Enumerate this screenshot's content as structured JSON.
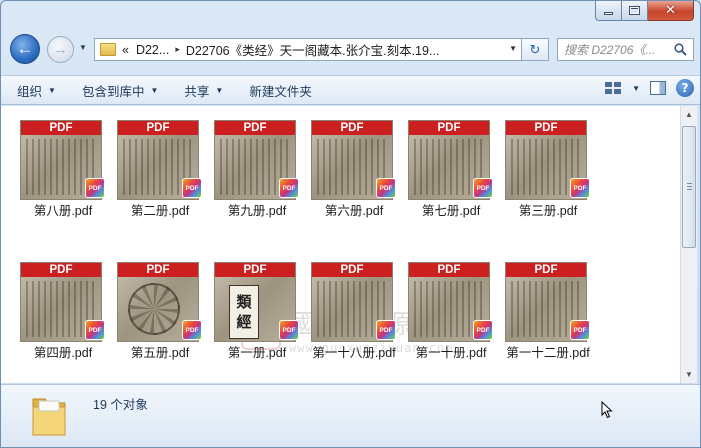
{
  "window": {
    "minimize_glyph": "",
    "maximize_glyph": "",
    "close_glyph": "✕"
  },
  "nav": {
    "back_glyph": "←",
    "forward_glyph": "→",
    "dropdown_glyph": "▼"
  },
  "address": {
    "chevron_left": "«",
    "crumb_1": "D22...",
    "crumb_2": "D22706《类经》天一阁藏本.张介宝.刻本.19...",
    "separator": "▸",
    "dropdown_glyph": "▼",
    "refresh_glyph": "↻"
  },
  "search": {
    "placeholder": "搜索 D22706《...",
    "icon": "magnifier-icon"
  },
  "toolbar": {
    "organize": "组织",
    "include_in_library": "包含到库中",
    "share": "共享",
    "new_folder": "新建文件夹",
    "caret": "▼",
    "views_icon": "views-icon",
    "preview_pane_icon": "preview-pane-icon",
    "help_glyph": "?"
  },
  "files": [
    {
      "name": "第八册.pdf",
      "thumb": "text"
    },
    {
      "name": "第二册.pdf",
      "thumb": "text"
    },
    {
      "name": "第九册.pdf",
      "thumb": "text"
    },
    {
      "name": "第六册.pdf",
      "thumb": "text"
    },
    {
      "name": "第七册.pdf",
      "thumb": "text"
    },
    {
      "name": "第三册.pdf",
      "thumb": "text"
    },
    {
      "name": "第四册.pdf",
      "thumb": "text"
    },
    {
      "name": "第五册.pdf",
      "thumb": "wheel"
    },
    {
      "name": "第一册.pdf",
      "thumb": "cover"
    },
    {
      "name": "第一十八册.pdf",
      "thumb": "text"
    },
    {
      "name": "第一十册.pdf",
      "thumb": "text"
    },
    {
      "name": "第一十二册.pdf",
      "thumb": "text"
    }
  ],
  "thumb_banner": "PDF",
  "badge_text": "PDF",
  "cover_chars": [
    "類",
    "經"
  ],
  "watermark": {
    "seal": "國",
    "chinese": "國學資源網",
    "url": "www.guoxueziyuan.com"
  },
  "scrollbar": {
    "up_glyph": "▲",
    "down_glyph": "▼"
  },
  "details": {
    "count_text": "19 个对象"
  },
  "colors": {
    "pdf_red": "#cc1f1f",
    "chrome_blue": "#c6d9ee",
    "text_blue": "#1e395b"
  }
}
